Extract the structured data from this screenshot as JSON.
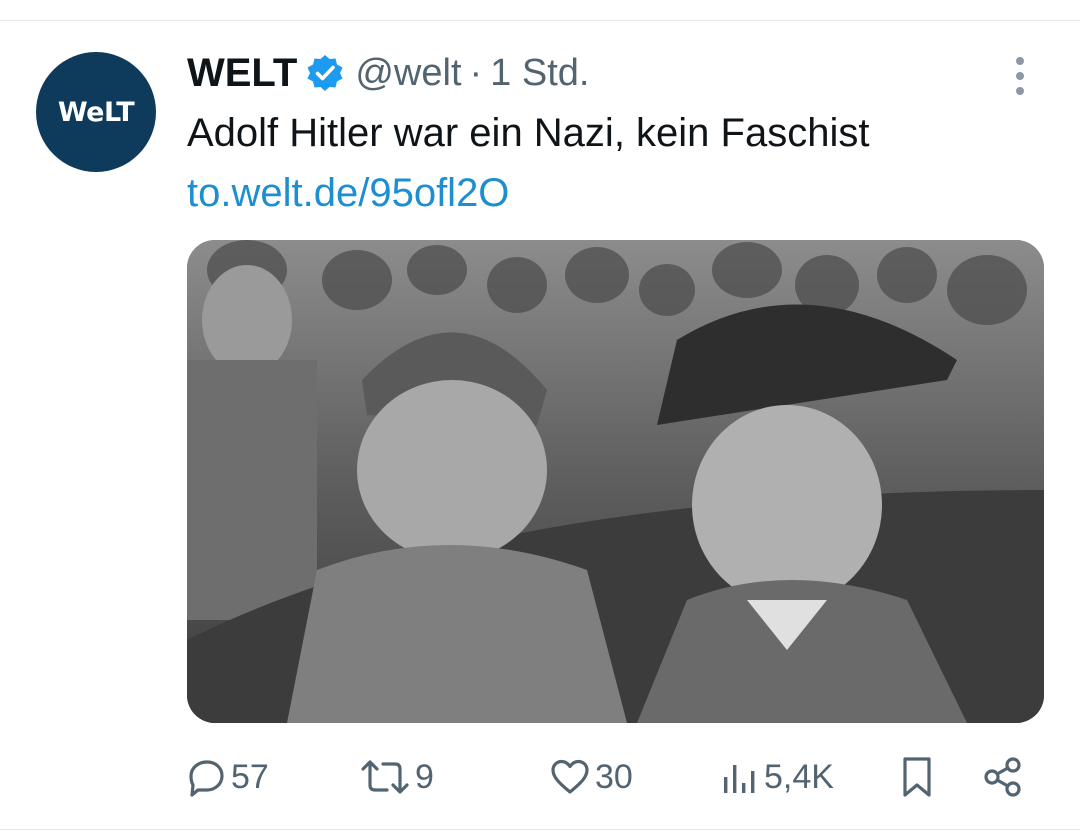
{
  "tweet": {
    "avatar_logo": "WeLT",
    "display_name": "WELT",
    "handle": "@welt",
    "separator": "·",
    "time": "1 Std.",
    "text": "Adolf Hitler war ein Nazi, kein Faschist",
    "link": "to.welt.de/95ofl2O",
    "media_icon": "photo-image"
  },
  "actions": {
    "replies": "57",
    "reposts": "9",
    "likes": "30",
    "views": "5,4K"
  },
  "icons": {
    "verified": "verified-badge-icon",
    "more": "more-vertical-icon",
    "reply": "reply-icon",
    "repost": "repost-icon",
    "like": "heart-icon",
    "views": "views-bar-icon",
    "bookmark": "bookmark-icon",
    "share": "share-icon"
  },
  "colors": {
    "brand_avatar": "#0e3a5c",
    "verified": "#1d9bf0",
    "link": "#1d8fd0",
    "secondary_text": "#536471"
  }
}
